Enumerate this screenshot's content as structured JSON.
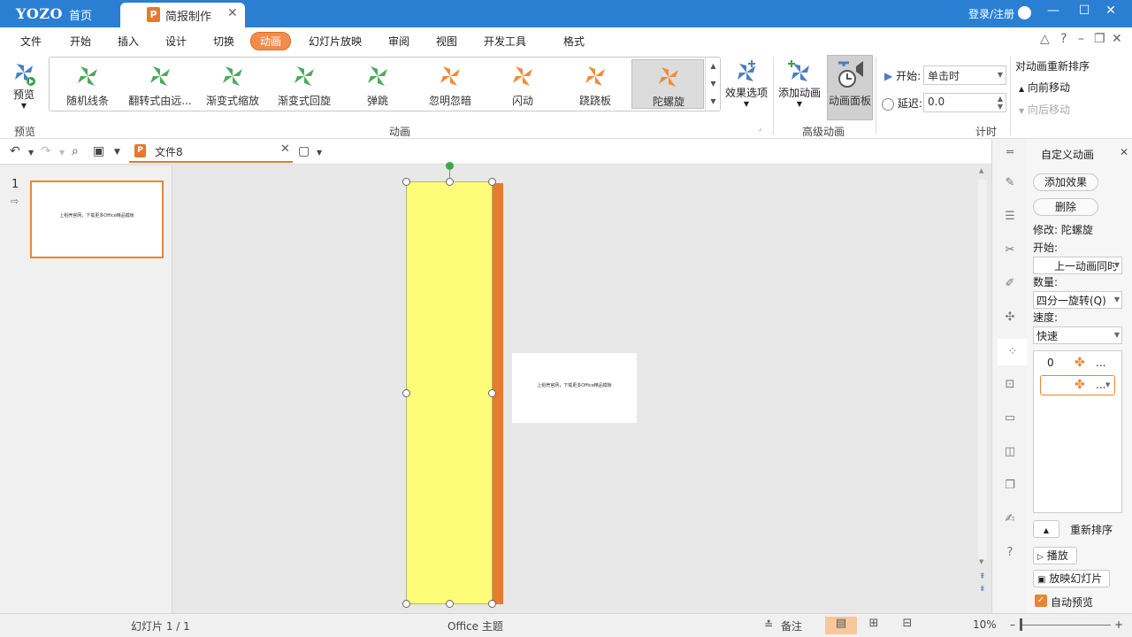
{
  "app": {
    "logo": "YOZO",
    "home_tab": "首页",
    "doc_tab": "简报制作",
    "login": "登录/注册"
  },
  "menu": {
    "items": [
      "文件",
      "开始",
      "插入",
      "设计",
      "切换",
      "动画",
      "幻灯片放映",
      "审阅",
      "视图",
      "开发工具",
      "格式"
    ],
    "active": "动画"
  },
  "ribbon": {
    "preview_label": "预览",
    "preview_group": "预览",
    "gallery": [
      {
        "label": "随机线条",
        "color": "#4daa5b"
      },
      {
        "label": "翻转式由远...",
        "color": "#4daa5b"
      },
      {
        "label": "渐变式缩放",
        "color": "#4daa5b"
      },
      {
        "label": "渐变式回旋",
        "color": "#4daa5b"
      },
      {
        "label": "弹跳",
        "color": "#4daa5b"
      },
      {
        "label": "忽明忽暗",
        "color": "#f08a3c"
      },
      {
        "label": "闪动",
        "color": "#f08a3c"
      },
      {
        "label": "跷跷板",
        "color": "#f08a3c"
      },
      {
        "label": "陀螺旋",
        "color": "#f08a3c",
        "selected": true
      }
    ],
    "anim_group": "动画",
    "effect_options": "效果选项",
    "add_animation": "添加动画",
    "animation_pane": "动画面板",
    "advanced_group": "高级动画",
    "start_label": "开始:",
    "start_value": "单击时",
    "delay_label": "延迟:",
    "delay_value": "0.0",
    "reorder_title": "对动画重新排序",
    "move_earlier": "向前移动",
    "move_later": "向后移动",
    "timing_group": "计时"
  },
  "quickbar": {
    "file_name": "文件8"
  },
  "thumbnails": {
    "slide_number": "1",
    "slide_text": "上稻壳官网，下载更多Office精品模板"
  },
  "canvas": {
    "slide_text": "上稻壳官网，下载更多Office精品模板",
    "fill_color": "#fffc7a",
    "edge_color": "#ea7a2c"
  },
  "anim_panel": {
    "title": "自定义动画",
    "add_effect": "添加效果",
    "delete": "删除",
    "modify": "修改: 陀螺旋",
    "start_label": "开始:",
    "start_value": "上一动画同时",
    "amount_label": "数量:",
    "amount_value": "四分一旋转(Q)",
    "speed_label": "速度:",
    "speed_value": "快速",
    "list_items": [
      {
        "index": "0",
        "more": "..."
      },
      {
        "index": "",
        "more": "..."
      }
    ],
    "reorder": "重新排序",
    "play": "播放",
    "slideshow": "放映幻灯片",
    "auto_preview": "自动预览"
  },
  "status": {
    "slide_info": "幻灯片 1 / 1",
    "theme": "Office 主题",
    "notes": "备注",
    "zoom": "10%"
  }
}
